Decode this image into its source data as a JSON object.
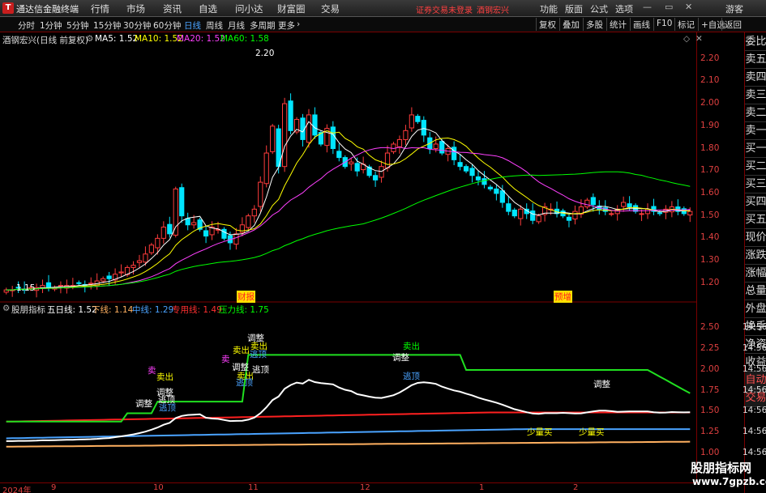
{
  "titlebar": {
    "app_name": "通达信金融终端",
    "menus": [
      "行情",
      "市场",
      "资讯",
      "自选",
      "问小达",
      "财富圈",
      "交易"
    ],
    "warning": "证券交易未登录",
    "stock": "酒钢宏兴",
    "right_menus": [
      "功能",
      "版面",
      "公式",
      "选项"
    ],
    "guest": "游客"
  },
  "toolbar": {
    "periods": [
      "分时",
      "1分钟",
      "5分钟",
      "15分钟",
      "30分钟",
      "60分钟",
      "日线",
      "周线",
      "月线",
      "多周期",
      "更多"
    ],
    "active_period": "日线",
    "right_buttons": [
      "复权",
      "叠加",
      "多股",
      "统计",
      "画线",
      "F10",
      "标记",
      "+自选",
      "返回"
    ]
  },
  "main_info": {
    "title": "酒钢宏兴(日线 前复权)",
    "ma5": "MA5: 1.52",
    "ma10": "MA10: 1.52",
    "ma20": "MA20: 1.52",
    "ma60": "MA60: 1.58",
    "high_label": "2.20",
    "low_label": "1.15",
    "tag1": "财报",
    "tag2": "预增",
    "colors": {
      "ma5": "#ffffff",
      "ma10": "#ffff00",
      "ma20": "#ff40ff",
      "ma60": "#00ff00"
    }
  },
  "price_axis": [
    "2.20",
    "2.10",
    "2.00",
    "1.90",
    "1.80",
    "1.70",
    "1.60",
    "1.50",
    "1.40",
    "1.30",
    "1.20"
  ],
  "indicator": {
    "name": "股朋指标",
    "five_day": "五日线: 1.52",
    "lower": "下线: 1.14",
    "middle": "中线: 1.29",
    "special": "专用线: 1.49",
    "pressure": "压力线: 1.75",
    "axis": [
      "2.50",
      "2.25",
      "2.00",
      "1.75",
      "1.50",
      "1.25",
      "1.00"
    ]
  },
  "annotations": {
    "sell": "卖出",
    "adjust": "调整",
    "escape": "逃顶",
    "small_buy": "少量买",
    "sell_short": "卖"
  },
  "right_sidebar": [
    "委比",
    "卖五",
    "卖四",
    "卖三",
    "卖二",
    "卖一",
    "买一",
    "买二",
    "买三",
    "买四",
    "买五",
    "现价",
    "涨跌",
    "涨幅",
    "总量",
    "外盘",
    "换手",
    "净资",
    "收益",
    "自动",
    "交易"
  ],
  "right_time_ticks": [
    "14:56",
    "14:56",
    "14:56",
    "14:56",
    "14:56",
    "14:56",
    "14:56"
  ],
  "dates": [
    "2024年",
    "9",
    "10",
    "11",
    "12",
    "1",
    "2"
  ],
  "watermark": {
    "line1": "股朋指标网",
    "line2": "www.7gpzb.com"
  },
  "chart_data": {
    "type": "candlestick",
    "ylim": [
      1.12,
      2.26
    ],
    "closes": [
      1.17,
      1.17,
      1.18,
      1.17,
      1.18,
      1.18,
      1.19,
      1.18,
      1.18,
      1.19,
      1.19,
      1.19,
      1.2,
      1.19,
      1.2,
      1.21,
      1.22,
      1.22,
      1.24,
      1.25,
      1.27,
      1.28,
      1.3,
      1.33,
      1.37,
      1.4,
      1.45,
      1.42,
      1.62,
      1.5,
      1.46,
      1.47,
      1.44,
      1.41,
      1.45,
      1.44,
      1.4,
      1.38,
      1.42,
      1.46,
      1.5,
      1.53,
      1.65,
      1.78,
      1.9,
      1.72,
      2.0,
      1.88,
      1.93,
      1.84,
      1.95,
      1.86,
      1.82,
      1.89,
      1.8,
      1.76,
      1.72,
      1.74,
      1.7,
      1.73,
      1.68,
      1.66,
      1.72,
      1.78,
      1.82,
      1.84,
      1.88,
      1.95,
      1.92,
      1.86,
      1.8,
      1.82,
      1.78,
      1.8,
      1.75,
      1.72,
      1.7,
      1.68,
      1.66,
      1.64,
      1.62,
      1.6,
      1.56,
      1.52,
      1.5,
      1.53,
      1.51,
      1.48,
      1.5,
      1.54,
      1.53,
      1.51,
      1.5,
      1.48,
      1.52,
      1.54,
      1.57,
      1.55,
      1.53,
      1.52,
      1.51,
      1.53,
      1.56,
      1.54,
      1.52,
      1.51,
      1.53,
      1.52,
      1.51,
      1.53,
      1.54,
      1.52,
      1.51,
      1.52
    ],
    "ma_last": {
      "MA5": 1.52,
      "MA10": 1.52,
      "MA20": 1.52,
      "MA60": 1.58
    }
  }
}
